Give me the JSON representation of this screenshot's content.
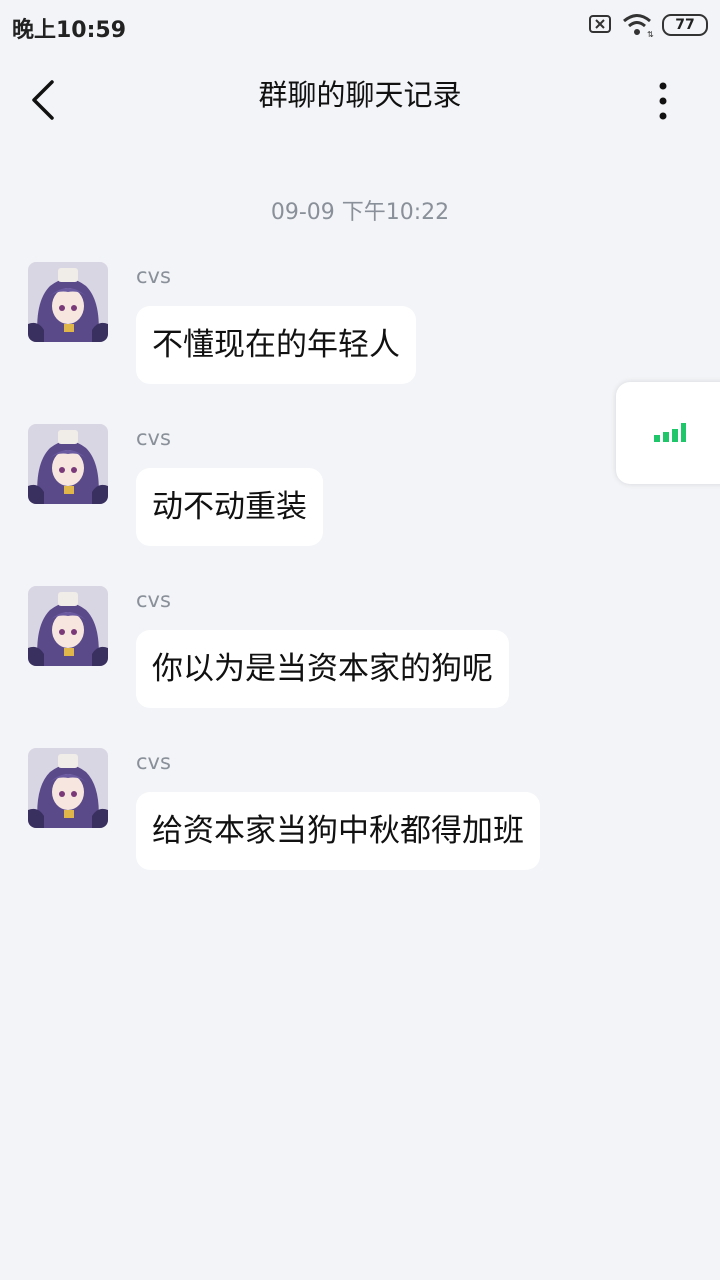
{
  "status_bar": {
    "time": "晚上10:59",
    "battery": "77",
    "icons": [
      "close-box-icon",
      "wifi-icon",
      "battery-icon"
    ]
  },
  "header": {
    "title": "群聊的聊天记录",
    "back_icon": "chevron-left-icon",
    "more_icon": "more-vertical-icon"
  },
  "timestamp": "09-09 下午10:22",
  "messages": [
    {
      "sender": "cvs",
      "text": "不懂现在的年轻人"
    },
    {
      "sender": "cvs",
      "text": "动不动重装"
    },
    {
      "sender": "cvs",
      "text": "你以为是当资本家的狗呢"
    },
    {
      "sender": "cvs",
      "text": "给资本家当狗中秋都得加班"
    }
  ],
  "floating_widget": {
    "icon": "signal-bars-icon",
    "color": "#1fc76a"
  }
}
